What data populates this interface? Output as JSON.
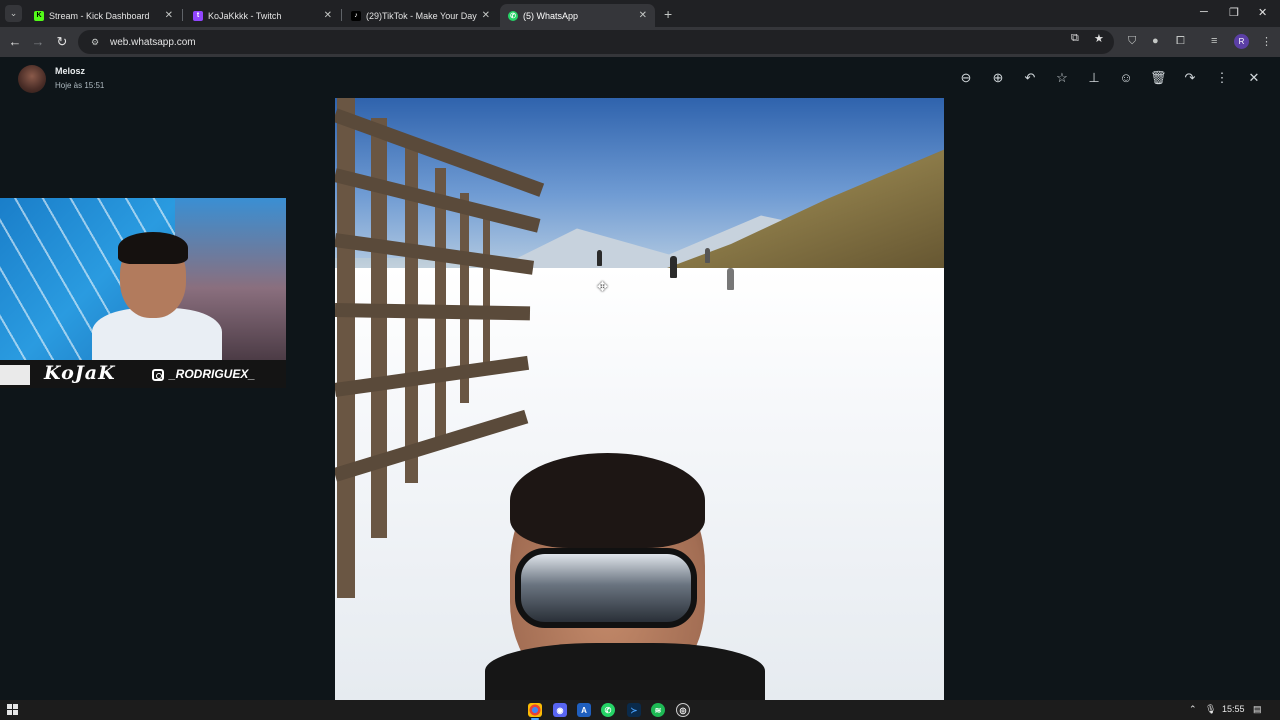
{
  "browser": {
    "tabs": [
      {
        "title": "Stream - Kick Dashboard",
        "icon": "kick-icon",
        "color": "#53fc18"
      },
      {
        "title": "KoJaKkkk - Twitch",
        "icon": "twitch-icon",
        "color": "#9146ff"
      },
      {
        "title": "(29)TikTok - Make Your Day",
        "icon": "tiktok-icon",
        "color": "#ffffff"
      },
      {
        "title": "(5) WhatsApp",
        "icon": "whatsapp-icon",
        "color": "#25d366",
        "active": true
      }
    ],
    "url": "web.whatsapp.com",
    "profile_initial": "R"
  },
  "viewer": {
    "sender_name": "Melosz",
    "timestamp": "Hoje às 15:51",
    "tools": [
      "zoom-out-icon",
      "zoom-in-icon",
      "reply-icon",
      "star-icon",
      "pin-icon",
      "emoji-icon",
      "delete-icon",
      "forward-icon",
      "more-icon",
      "close-icon"
    ]
  },
  "webcam": {
    "logo": "KoJaK",
    "instagram_handle": "_RODRIGUEX_"
  },
  "taskbar": {
    "apps": [
      "chrome-icon",
      "discord-icon",
      "app-a-icon",
      "whatsapp-icon",
      "vscode-icon",
      "spotify-icon",
      "obs-icon"
    ],
    "time": "15:55"
  },
  "colors": {
    "whatsapp_bg": "#111b21",
    "chrome_dark": "#202124",
    "chrome_toolbar": "#35363a"
  }
}
